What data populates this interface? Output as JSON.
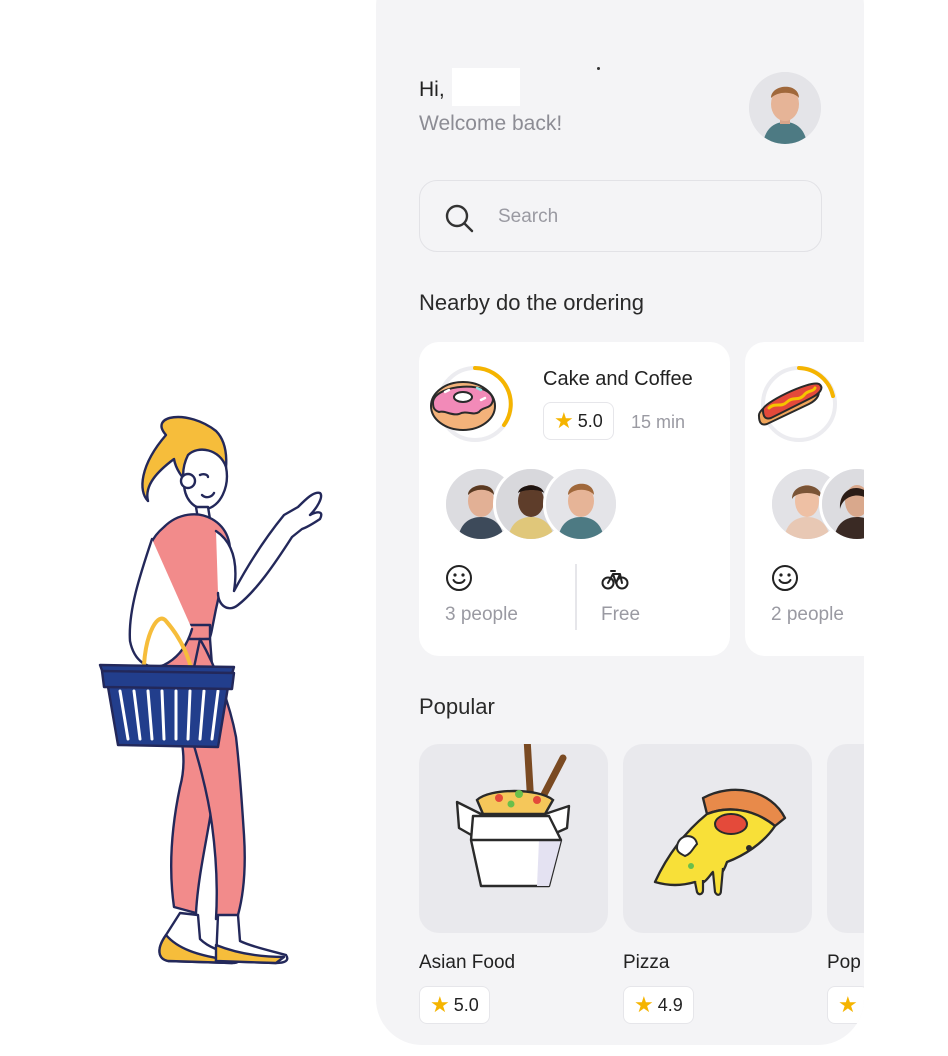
{
  "greeting": {
    "hi": "Hi,",
    "subtitle": "Welcome back!"
  },
  "search": {
    "placeholder": "Search",
    "icon": "search-icon"
  },
  "nearby": {
    "heading": "Nearby do the ordering",
    "cards": [
      {
        "title": "Cake and Coffee",
        "rating": "5.0",
        "time": "15 min",
        "icon": "donut-icon",
        "progress": 0.45,
        "people_label": "3 people",
        "delivery_label": "Free"
      },
      {
        "title": "",
        "icon": "hotdog-icon",
        "progress": 0.3,
        "people_label": "2 people"
      }
    ]
  },
  "popular": {
    "heading": "Popular",
    "items": [
      {
        "name": "Asian Food",
        "rating": "5.0",
        "icon": "noodle-box-icon"
      },
      {
        "name": "Pizza",
        "rating": "4.9",
        "icon": "pizza-slice-icon"
      },
      {
        "name": "Pop",
        "rating": "",
        "icon": ""
      }
    ]
  },
  "colors": {
    "background": "#f4f4f6",
    "card": "#ffffff",
    "accent": "#f5b400",
    "muted_text": "#9a9aa2"
  }
}
